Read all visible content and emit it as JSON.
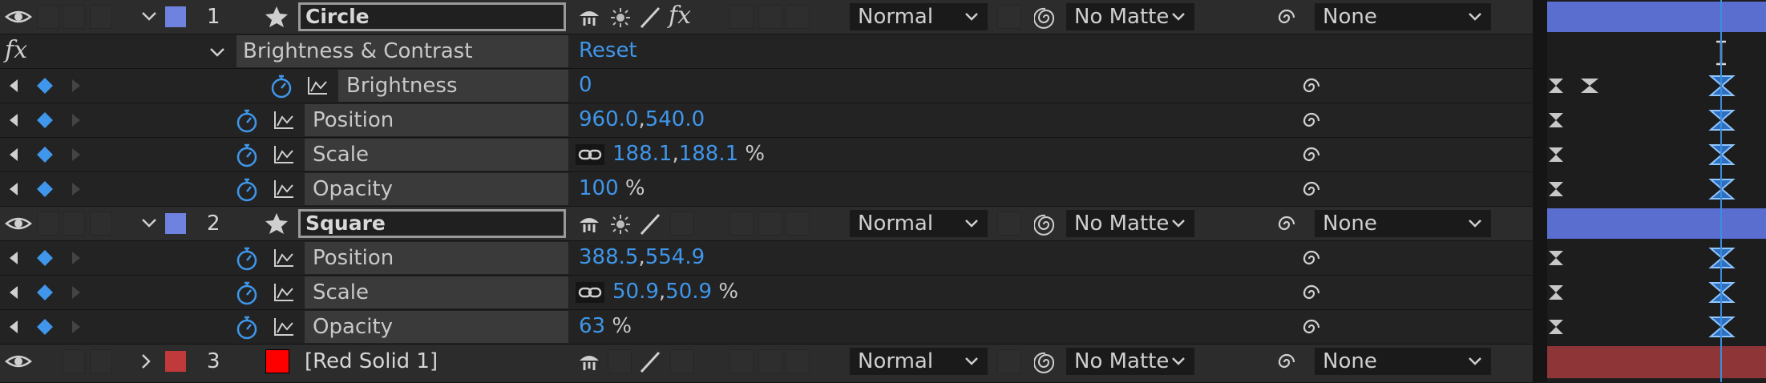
{
  "layers": [
    {
      "number": "1",
      "name": "Circle",
      "label_color": "#6f82e0",
      "mode": "Normal",
      "matte": "No Matte",
      "parent": "None",
      "has_fx": true,
      "bar_color": "#5a6ed0"
    },
    {
      "number": "2",
      "name": "Square",
      "label_color": "#6f82e0",
      "mode": "Normal",
      "matte": "No Matte",
      "parent": "None",
      "has_fx": false,
      "bar_color": "#5a6ed0"
    },
    {
      "number": "3",
      "name": "[Red Solid 1]",
      "label_color": "#c0393b",
      "mode": "Normal",
      "matte": "No Matte",
      "parent": "None",
      "has_fx": false,
      "bar_color": "#8e3537",
      "swatch_color": "#ff0000"
    }
  ],
  "effect": {
    "fx_label": "fx",
    "name": "Brightness & Contrast",
    "reset_label": "Reset"
  },
  "circle_props": {
    "brightness": {
      "label": "Brightness",
      "value": "0"
    },
    "position": {
      "label": "Position",
      "x": "960.0",
      "y": "540.0"
    },
    "scale": {
      "label": "Scale",
      "x": "188.1",
      "y": "188.1",
      "unit": "%"
    },
    "opacity": {
      "label": "Opacity",
      "value": "100",
      "unit": "%"
    }
  },
  "square_props": {
    "position": {
      "label": "Position",
      "x": "388.5",
      "y": "554.9"
    },
    "scale": {
      "label": "Scale",
      "x": "50.9",
      "y": "50.9",
      "unit": "%"
    },
    "opacity": {
      "label": "Opacity",
      "value": "63",
      "unit": "%"
    }
  },
  "comma": ",",
  "colors": {
    "accent_blue": "#3f96ea",
    "playhead": "#3a8de0"
  }
}
